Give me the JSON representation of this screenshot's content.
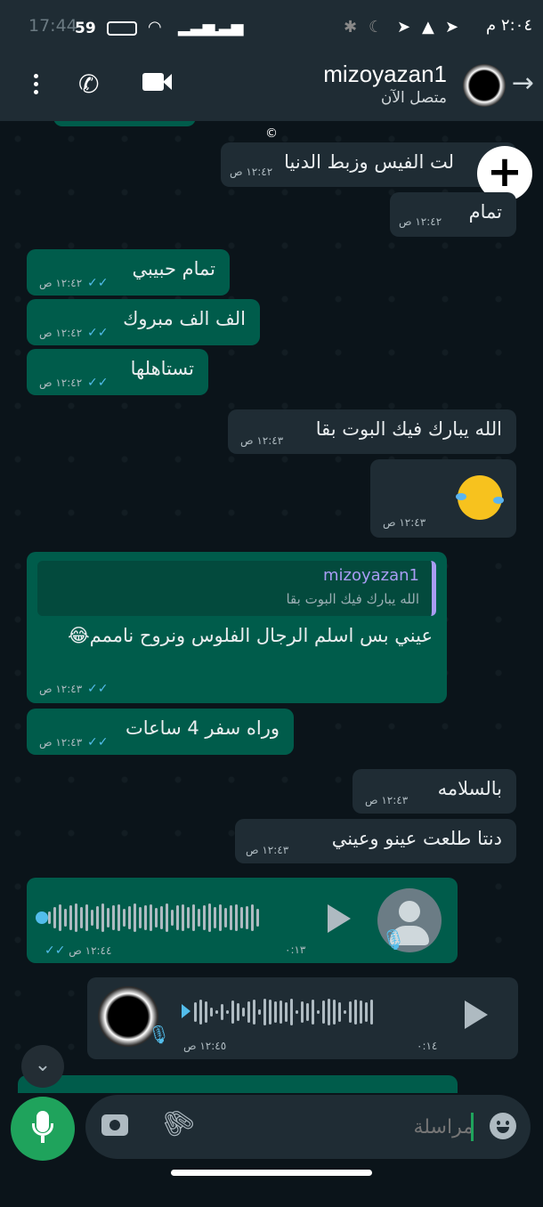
{
  "status_bar": {
    "time_left": "17:44",
    "battery_left": "59",
    "time_right": "٢:٠٤ م"
  },
  "header": {
    "contact_name": "mizoyazan1",
    "presence": "متصل الآن",
    "icons": [
      "more-vert-icon",
      "phone-icon",
      "video-call-icon",
      "back-arrow-icon"
    ]
  },
  "messages": [
    {
      "dir": "in",
      "text": "لت الفيس وزبط الدنيا",
      "time": "١٢:٤٢ ص"
    },
    {
      "dir": "in",
      "text": "تمام",
      "time": "١٢:٤٢ ص"
    },
    {
      "dir": "out",
      "text": "تمام حبيبي",
      "time": "١٢:٤٢ ص"
    },
    {
      "dir": "out",
      "text": "الف الف مبروك",
      "time": "١٢:٤٢ ص"
    },
    {
      "dir": "out",
      "text": "تستاهلها",
      "time": "١٢:٤٢ ص"
    },
    {
      "dir": "in",
      "text": "الله يبارك فيك البوت بقا",
      "time": "١٢:٤٣ ص"
    },
    {
      "dir": "in",
      "text": "",
      "time": "١٢:٤٣ ص",
      "emoji": "rolling-laughing-emoji"
    },
    {
      "dir": "out",
      "text": "عيني بس اسلم الرجال الفلوس ونروح ناممم😂",
      "time": "١٢:٤٣ ص",
      "quote": {
        "name": "mizoyazan1",
        "text": "الله يبارك فيك البوت بقا"
      }
    },
    {
      "dir": "out",
      "text": "وراه سفر 4 ساعات",
      "time": "١٢:٤٣ ص"
    },
    {
      "dir": "in",
      "text": "بالسلامه",
      "time": "١٢:٤٣ ص"
    },
    {
      "dir": "in",
      "text": "دنتا طلعت عينو وعيني",
      "time": "١٢:٤٣ ص"
    },
    {
      "dir": "out",
      "type": "voice",
      "duration": "٠:١٣",
      "time": "١٢:٤٤ ص"
    },
    {
      "dir": "in",
      "type": "voice",
      "duration": "٠:١٤",
      "time": "١٢:٤٥ ص"
    }
  ],
  "composer": {
    "placeholder": "مراسلة"
  },
  "copyright_mark": "©",
  "colors": {
    "incoming_bubble": "#1f2c34",
    "outgoing_bubble": "#005c4b",
    "accent_green": "#1fa35c",
    "read_ticks": "#53bdeb"
  }
}
